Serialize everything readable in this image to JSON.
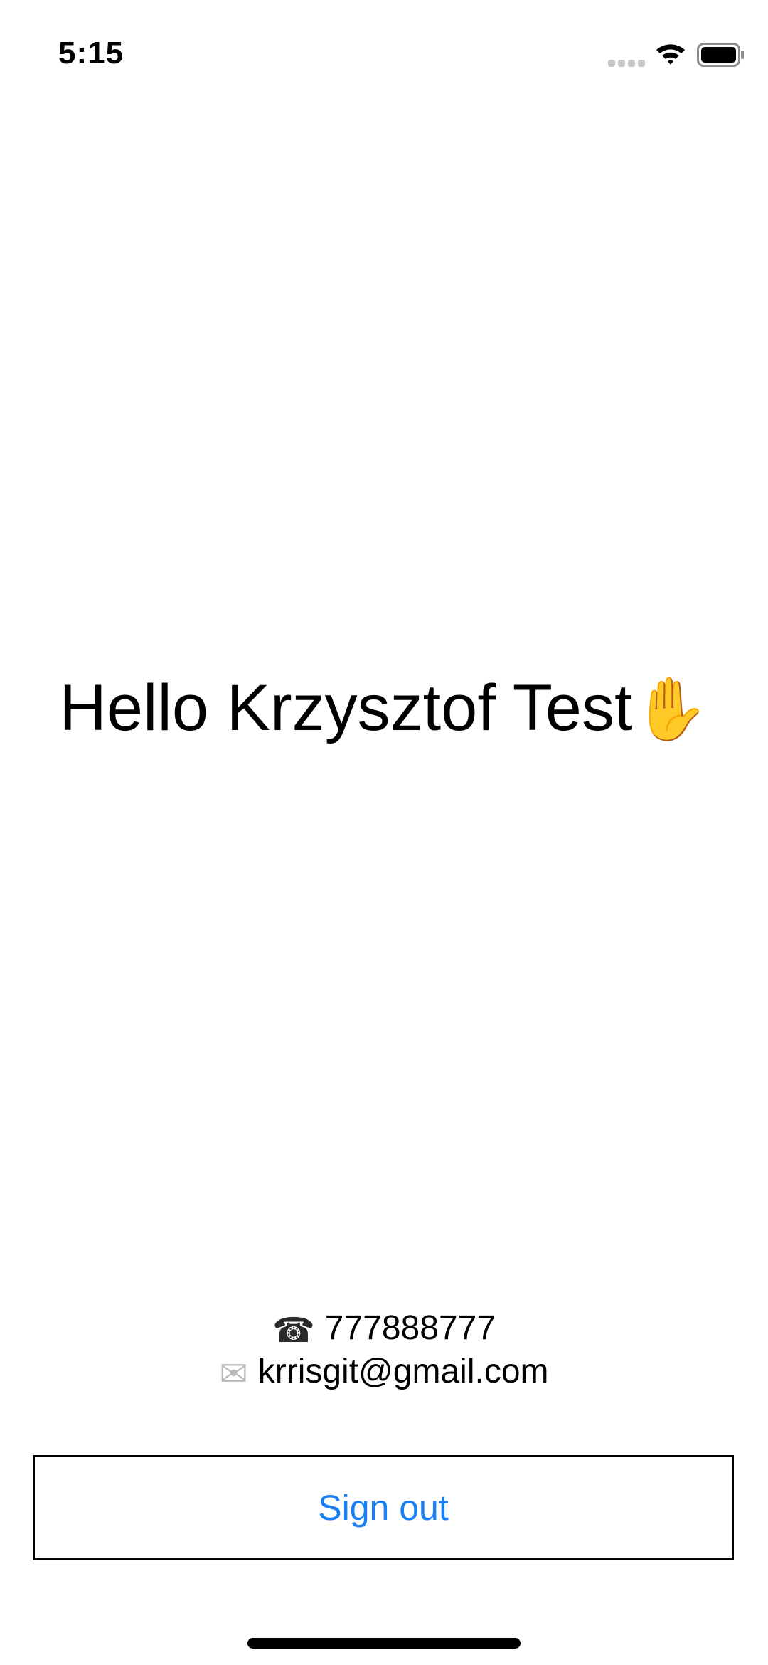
{
  "status_bar": {
    "time": "5:15",
    "icons": [
      "signal-icon",
      "wifi-icon",
      "battery-icon"
    ]
  },
  "greeting": {
    "text": "Hello Krzysztof Test",
    "icon": "waving-hand-icon"
  },
  "contact": {
    "phone_icon": "mobile-phone-icon",
    "phone": "777888777",
    "email_icon": "envelope-icon",
    "email": "krrisgit@gmail.com"
  },
  "actions": {
    "sign_out_label": "Sign out"
  },
  "colors": {
    "accent": "#1a7ff5",
    "text": "#000000",
    "background": "#ffffff"
  }
}
